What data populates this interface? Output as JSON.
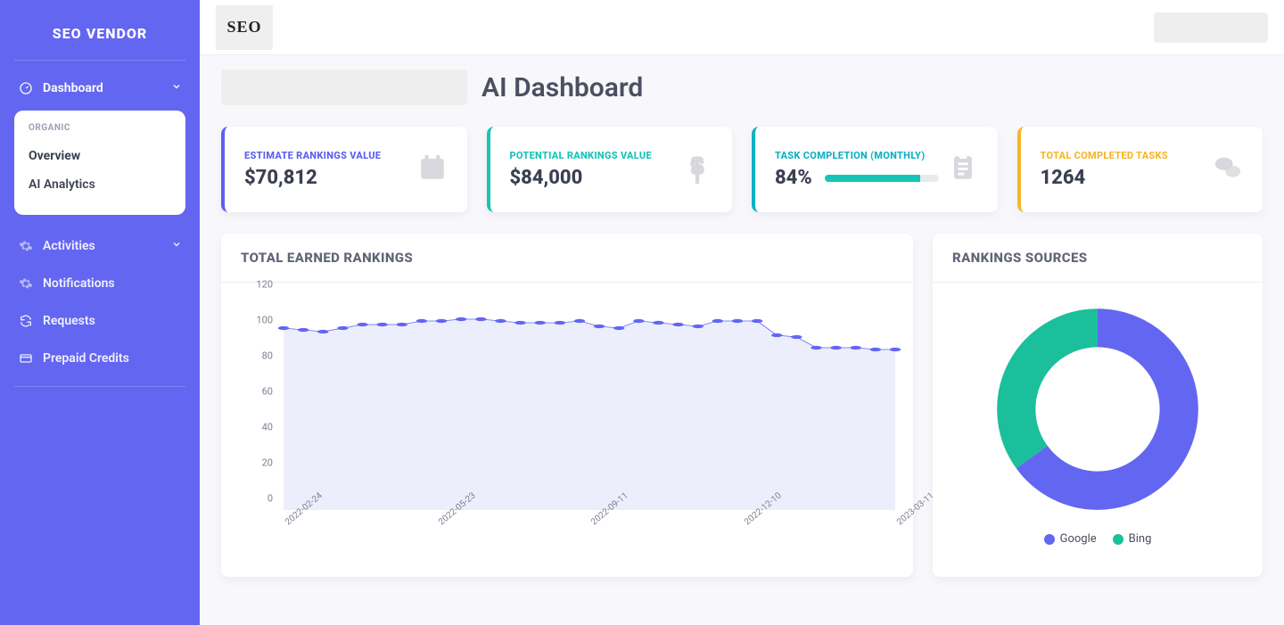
{
  "brand": "SEO VENDOR",
  "logo_text": "SEO",
  "sidebar": {
    "dashboard": "Dashboard",
    "sub_category": "ORGANIC",
    "overview": "Overview",
    "ai_analytics": "AI Analytics",
    "activities": "Activities",
    "notifications": "Notifications",
    "requests": "Requests",
    "prepaid": "Prepaid Credits"
  },
  "page_title": "AI Dashboard",
  "stats": {
    "estimate": {
      "label": "ESTIMATE RANKINGS VALUE",
      "value": "$70,812"
    },
    "potential": {
      "label": "POTENTIAL RANKINGS VALUE",
      "value": "$84,000"
    },
    "task": {
      "label": "TASK COMPLETION (MONTHLY)",
      "value": "84%",
      "percent": 84
    },
    "completed": {
      "label": "TOTAL COMPLETED TASKS",
      "value": "1264"
    }
  },
  "line_panel": {
    "title": "TOTAL EARNED RANKINGS"
  },
  "donut_panel": {
    "title": "RANKINGS SOURCES",
    "legend_google": "Google",
    "legend_bing": "Bing"
  },
  "chart_data": [
    {
      "type": "line",
      "title": "TOTAL EARNED RANKINGS",
      "xlabel": "",
      "ylabel": "",
      "ylim": [
        0,
        120
      ],
      "y_ticks": [
        0,
        20,
        40,
        60,
        80,
        100,
        120
      ],
      "x_tick_labels": [
        "2022-02-24",
        "2022-05-23",
        "2022-09-11",
        "2022-12-10",
        "2023-03-11"
      ],
      "series": [
        {
          "name": "Rankings",
          "color": "#6366f1",
          "values": [
            102,
            101,
            100,
            102,
            104,
            104,
            104,
            106,
            106,
            107,
            107,
            106,
            105,
            105,
            105,
            106,
            103,
            102,
            106,
            105,
            104,
            103,
            106,
            106,
            106,
            98,
            97,
            91,
            91,
            91,
            90,
            90
          ]
        }
      ]
    },
    {
      "type": "pie",
      "title": "RANKINGS SOURCES",
      "holes": true,
      "series": [
        {
          "name": "Google",
          "value": 65,
          "color": "#6366f1"
        },
        {
          "name": "Bing",
          "value": 35,
          "color": "#1bbf9b"
        }
      ]
    }
  ]
}
